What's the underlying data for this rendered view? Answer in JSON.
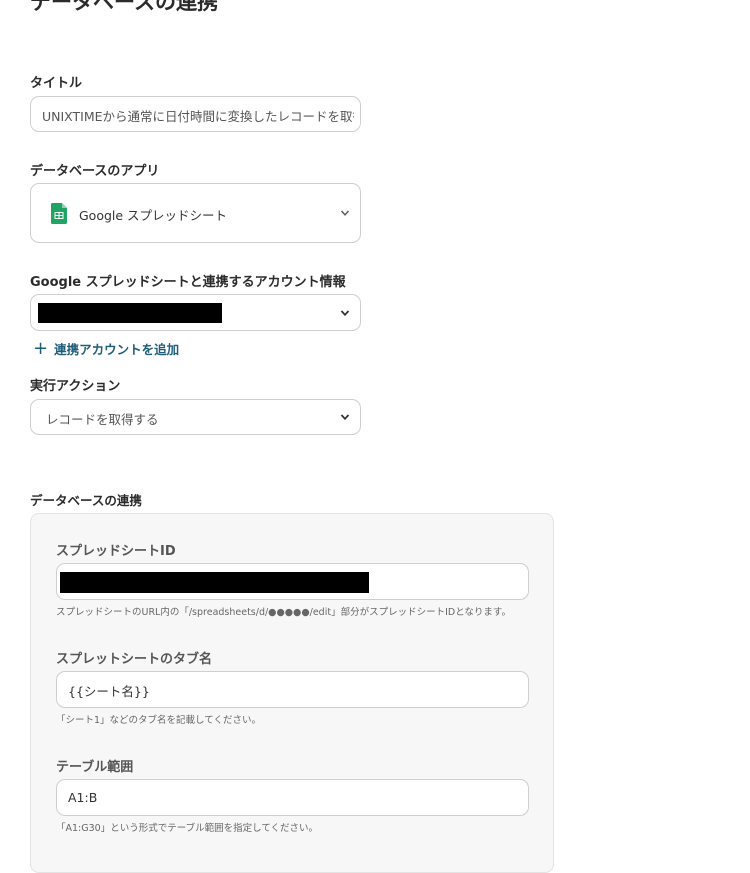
{
  "page": {
    "title": "データベースの連携"
  },
  "title_field": {
    "label": "タイトル",
    "value": "UNIXTIMEから通常に日付時間に変換したレコードを取得す"
  },
  "db_app": {
    "label": "データベースのアプリ",
    "value": "Google スプレッドシート",
    "icon": "google-sheets-icon",
    "icon_color": "#1fa463"
  },
  "account": {
    "label": "Google スプレッドシートと連携するアカウント情報",
    "add_label": "連携アカウントを追加",
    "link_color": "#1d5d79"
  },
  "action": {
    "label": "実行アクション",
    "value": "レコードを取得する"
  },
  "db_link": {
    "section_label": "データベースの連携",
    "spreadsheet_id": {
      "label": "スプレッドシートID",
      "hint": "スプレッドシートのURL内の「/spreadsheets/d/●●●●●/edit」部分がスプレッドシートIDとなります。"
    },
    "tab_name": {
      "label": "スプレットシートのタブ名",
      "value": "{{シート名}}",
      "hint": "「シート1」などのタブ名を記載してください。"
    },
    "table_range": {
      "label": "テーブル範囲",
      "value": "A1:B",
      "hint": "「A1:G30」という形式でテーブル範囲を指定してください。"
    }
  }
}
